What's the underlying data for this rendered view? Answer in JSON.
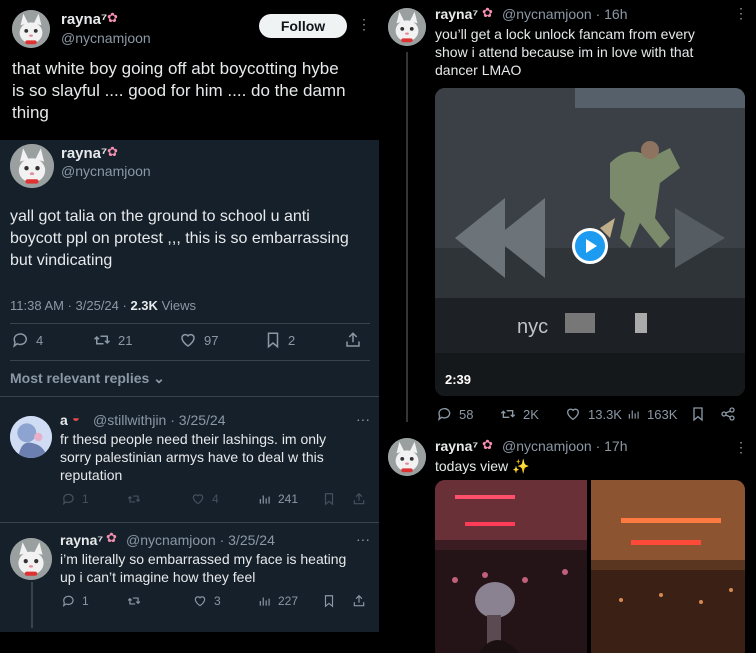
{
  "left_top": {
    "author_name": "rayna⁷",
    "author_handle": "@nycnamjoon",
    "follow_label": "Follow",
    "text_lines": [
      "that white boy going off abt boycotting hybe",
      "is so slayful .... good for him .... do the damn",
      "thing"
    ]
  },
  "main_tweet": {
    "author_name": "rayna⁷",
    "author_handle": "@nycnamjoon",
    "text_lines": [
      "yall got talia on the ground to school u anti",
      "boycott ppl on protest ,,, this is so embarrassing",
      "but vindicating"
    ],
    "time_date": "11:38 AM · 3/25/24 ·",
    "views_count": "2.3K",
    "views_label": "Views",
    "replies": "4",
    "retweets": "21",
    "likes": "97",
    "bookmarks": "2",
    "sort_label": "Most relevant replies"
  },
  "reply1": {
    "author_name": "a",
    "author_handle": "@stillwithjin · 3/25/24",
    "text_lines": [
      "fr thesd people need their lashings. im only",
      "sorry palestinian armys have to deal w this",
      "reputation"
    ],
    "replies": "1",
    "likes": "4",
    "views": "241"
  },
  "reply2": {
    "author_name": "rayna⁷",
    "author_handle": "@nycnamjoon · 3/25/24",
    "text_lines": [
      "i’m literally so embarrassed my face is heating",
      "up i can’t imagine how they feel"
    ],
    "replies": "1",
    "likes": "3",
    "views": "227"
  },
  "right_tweet1": {
    "author_name": "rayna⁷",
    "author_handle": "@nycnamjoon · 16h",
    "text_lines": [
      "you’ll get a lock unlock fancam from every",
      "show i attend because im in love with that",
      "dancer LMAO"
    ],
    "video_duration": "2:39",
    "video_watermark": "nyc",
    "replies": "58",
    "retweets": "2K",
    "likes": "13.3K",
    "views": "163K"
  },
  "right_tweet2": {
    "author_name": "rayna⁷",
    "author_handle": "@nycnamjoon · 17h",
    "text_lines": [
      "todays view ✨"
    ]
  },
  "colors": {
    "dim_bg": "#15202b",
    "black_bg": "#000000",
    "accent_blue": "#1d9bf0",
    "muted": "#8b98a5"
  }
}
